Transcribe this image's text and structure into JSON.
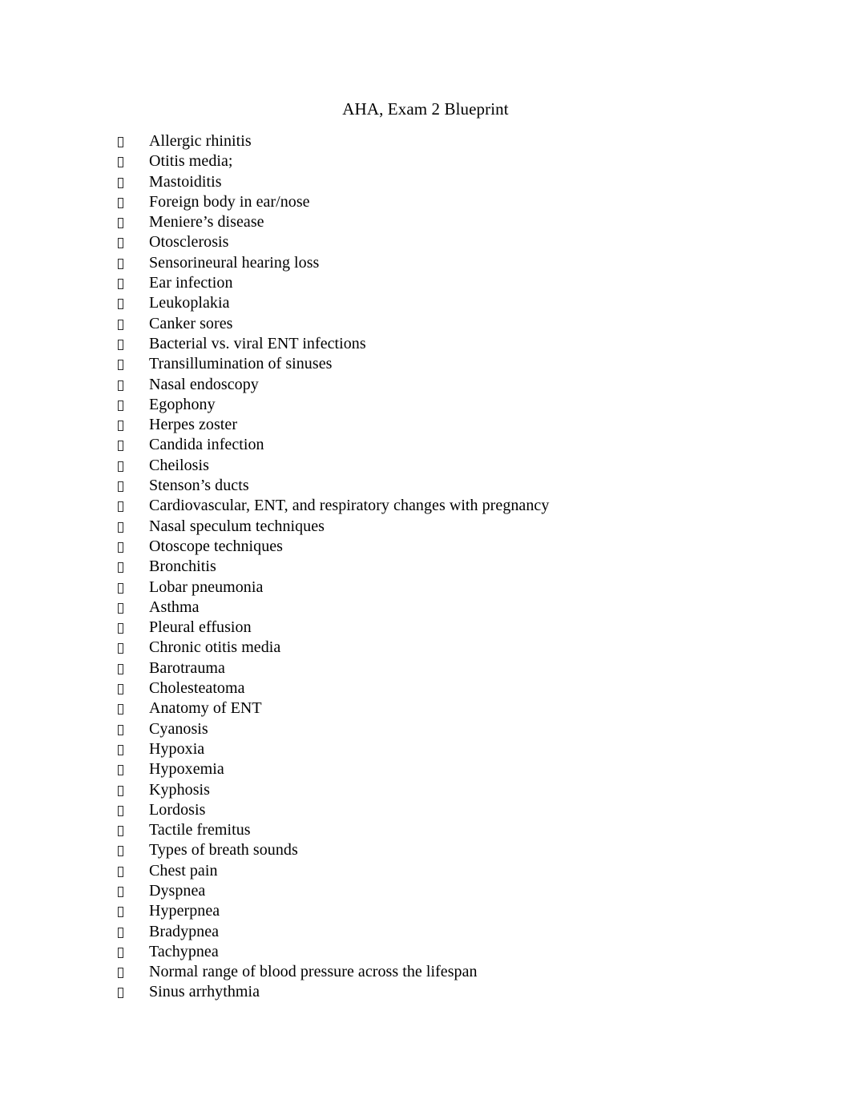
{
  "document": {
    "title": "AHA, Exam 2 Blueprint",
    "bullet_glyph": "❑",
    "bullet_render_note": "missing-glyph-box",
    "text_color": "#000000",
    "background_color": "#ffffff",
    "items": [
      {
        "label": "Allergic rhinitis"
      },
      {
        "label": "Otitis media;"
      },
      {
        "label": "Mastoiditis"
      },
      {
        "label": "Foreign body in ear/nose"
      },
      {
        "label": "Meniere’s disease"
      },
      {
        "label": "Otosclerosis"
      },
      {
        "label": "Sensorineural hearing loss"
      },
      {
        "label": "Ear infection"
      },
      {
        "label": "Leukoplakia"
      },
      {
        "label": "Canker sores"
      },
      {
        "label": "Bacterial vs. viral ENT infections"
      },
      {
        "label": "Transillumination of sinuses"
      },
      {
        "label": "Nasal endoscopy"
      },
      {
        "label": "Egophony"
      },
      {
        "label": "Herpes zoster"
      },
      {
        "label": "Candida infection"
      },
      {
        "label": "Cheilosis"
      },
      {
        "label": "Stenson’s ducts"
      },
      {
        "label": "Cardiovascular, ENT, and respiratory changes with pregnancy"
      },
      {
        "label": "Nasal speculum techniques"
      },
      {
        "label": "Otoscope techniques"
      },
      {
        "label": "Bronchitis"
      },
      {
        "label": "Lobar pneumonia"
      },
      {
        "label": "Asthma"
      },
      {
        "label": "Pleural effusion"
      },
      {
        "label": "Chronic otitis media"
      },
      {
        "label": "Barotrauma"
      },
      {
        "label": "Cholesteatoma"
      },
      {
        "label": "Anatomy of ENT"
      },
      {
        "label": "Cyanosis"
      },
      {
        "label": "Hypoxia"
      },
      {
        "label": "Hypoxemia"
      },
      {
        "label": "Kyphosis"
      },
      {
        "label": "Lordosis"
      },
      {
        "label": "Tactile fremitus"
      },
      {
        "label": "Types of breath sounds"
      },
      {
        "label": "Chest pain"
      },
      {
        "label": "Dyspnea"
      },
      {
        "label": "Hyperpnea"
      },
      {
        "label": "Bradypnea"
      },
      {
        "label": "Tachypnea"
      },
      {
        "label": "Normal range of blood pressure across the lifespan"
      },
      {
        "label": "Sinus arrhythmia"
      }
    ]
  }
}
